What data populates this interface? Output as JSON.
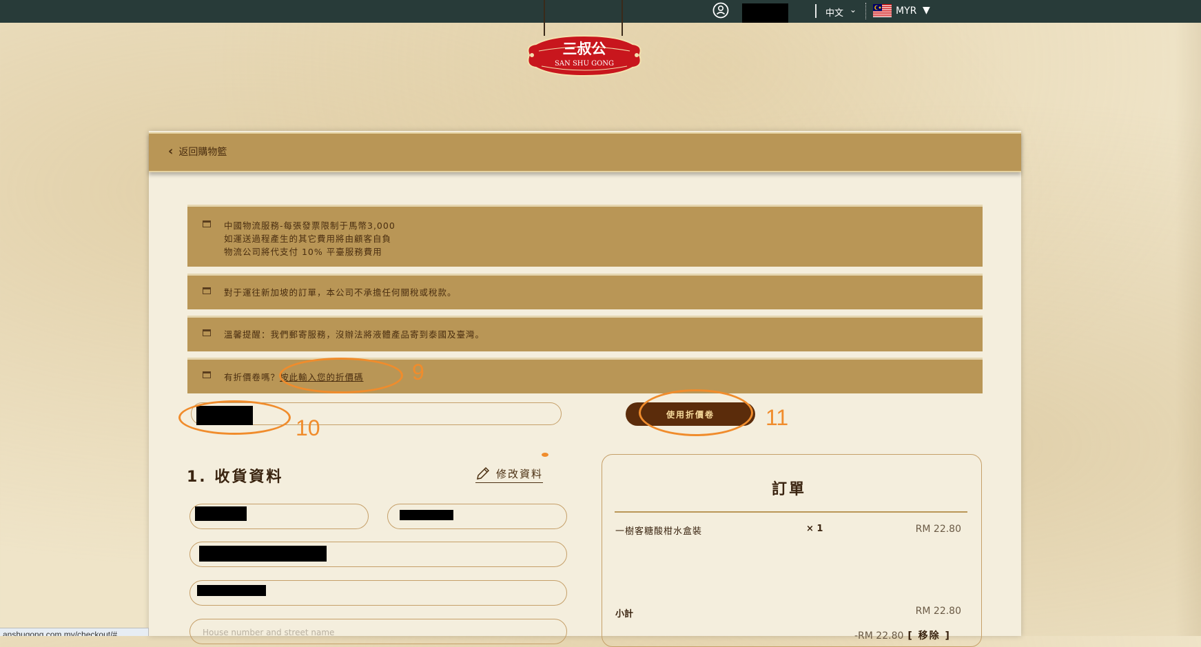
{
  "topbar": {
    "language": "中文",
    "currency": "MYR"
  },
  "logo": {
    "text_cn": "三叔公",
    "text_en": "SAN SHU GONG"
  },
  "header": {
    "back_label": "返回購物籃"
  },
  "notices": [
    {
      "lines": [
        "中國物流服務-每張發票限制于馬幣3,000",
        "如運送過程產生的其它費用將由顧客自負",
        "物流公司將代支付 10% 平臺服務費用"
      ]
    },
    {
      "lines": [
        "對于運往新加坡的訂單，本公司不承擔任何關稅或稅款。"
      ]
    },
    {
      "lines": [
        "溫馨提醒：我們郵寄服務，沒辦法將液體產品寄到泰國及臺灣。"
      ]
    }
  ],
  "coupon": {
    "prompt": "有折價卷嗎？",
    "link": "按此輸入您的折價碼",
    "apply_button": "使用折價卷"
  },
  "annotations": {
    "a9": "9",
    "a10": "10",
    "a11": "11"
  },
  "shipping": {
    "title": "1. 收貨資料",
    "edit_label": "修改資料",
    "address_placeholder": "House number and street name"
  },
  "order": {
    "title": "訂單",
    "items": [
      {
        "name": "一樹客糖酸柑水盒裝",
        "qty": "× 1",
        "price": "RM 22.80"
      }
    ],
    "subtotal_label": "小計",
    "subtotal": "RM 22.80",
    "discount": "-RM 22.80",
    "remove_label": "[ 移除 ]"
  },
  "statusbar": {
    "url": "anshugong.com.my/checkout/#"
  },
  "colors": {
    "topbar": "#283b39",
    "panel_header": "#b99656",
    "apply_button": "#5b2c0b",
    "annotation": "#f08c2c"
  }
}
